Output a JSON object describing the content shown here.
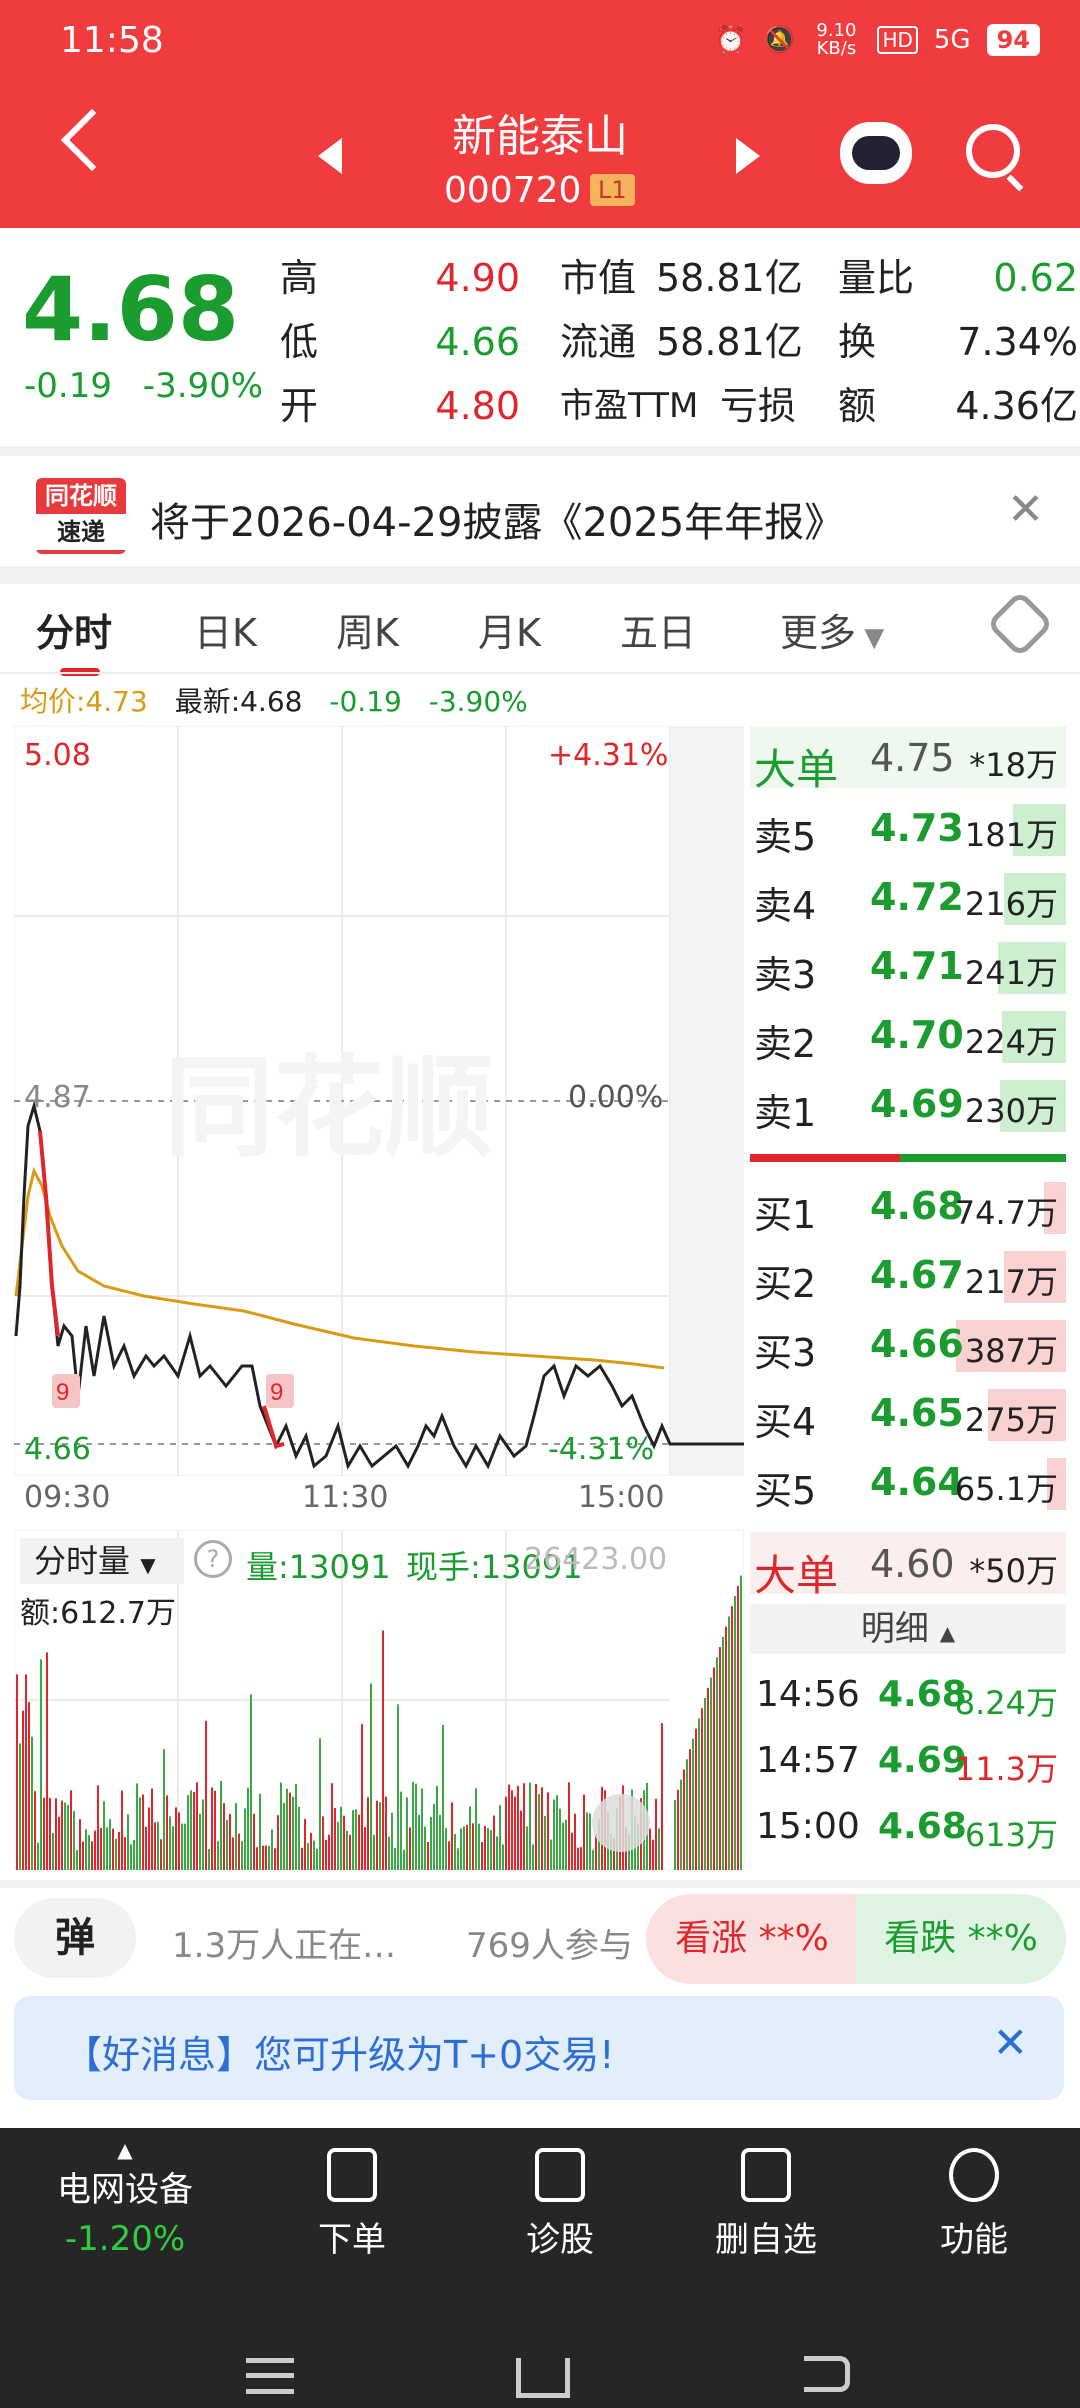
{
  "status": {
    "time": "11:58",
    "net_speed": "9.10 KB/s",
    "network": "5G",
    "battery": "94"
  },
  "header": {
    "stock_name": "新能泰山",
    "stock_code": "000720",
    "level": "L1"
  },
  "quote": {
    "price": "4.68",
    "change": "-0.19",
    "change_pct": "-3.90%",
    "high_label": "高",
    "high": "4.90",
    "low_label": "低",
    "low": "4.66",
    "open_label": "开",
    "open": "4.80",
    "mcap_label": "市值",
    "mcap": "58.81亿",
    "float_label": "流通",
    "float": "58.81亿",
    "pe_label": "市盈TTM",
    "pe": "亏损",
    "vol_ratio_label": "量比",
    "vol_ratio": "0.62",
    "turnover_label": "换",
    "turnover": "7.34%",
    "amount_label": "额",
    "amount": "4.36亿"
  },
  "notice": {
    "logo_top": "同花顺",
    "logo_bottom": "速递",
    "text": "将于2026-04-29披露《2025年年报》"
  },
  "tabs": [
    "分时",
    "日K",
    "周K",
    "月K",
    "五日",
    "更多"
  ],
  "info": {
    "avg": "均价:4.73",
    "latest": "最新:4.68",
    "chg": "-0.19",
    "pct": "-3.90%"
  },
  "chart": {
    "top_price": "5.08",
    "top_pct": "+4.31%",
    "mid_price": "4.87",
    "mid_pct": "0.00%",
    "low_price": "4.66",
    "low_pct": "-4.31%",
    "times": [
      "09:30",
      "11:30",
      "15:00"
    ],
    "watermark": "同花顺",
    "marker": "9"
  },
  "book": {
    "big_sell_label": "大单",
    "big_sell_price": "4.75",
    "big_sell_vol": "*18万",
    "asks": [
      {
        "name": "卖5",
        "price": "4.73",
        "vol": "181万",
        "w": 0.48
      },
      {
        "name": "卖4",
        "price": "4.72",
        "vol": "216万",
        "w": 0.56
      },
      {
        "name": "卖3",
        "price": "4.71",
        "vol": "241万",
        "w": 0.62
      },
      {
        "name": "卖2",
        "price": "4.70",
        "vol": "224万",
        "w": 0.58
      },
      {
        "name": "卖1",
        "price": "4.69",
        "vol": "230万",
        "w": 0.6
      }
    ],
    "bids": [
      {
        "name": "买1",
        "price": "4.68",
        "vol": "74.7万",
        "w": 0.2
      },
      {
        "name": "买2",
        "price": "4.67",
        "vol": "217万",
        "w": 0.56
      },
      {
        "name": "买3",
        "price": "4.66",
        "vol": "387万",
        "w": 1.0
      },
      {
        "name": "买4",
        "price": "4.65",
        "vol": "275万",
        "w": 0.71
      },
      {
        "name": "买5",
        "price": "4.64",
        "vol": "65.1万",
        "w": 0.17
      }
    ],
    "big_buy_label": "大单",
    "big_buy_price": "4.60",
    "big_buy_vol": "*50万"
  },
  "volume": {
    "label": "分时量",
    "vol": "量:13091",
    "cur": "现手:13091",
    "amount": "额:612.7万",
    "axis": "26423.00"
  },
  "detail": {
    "title": "明细",
    "rows": [
      {
        "time": "14:56",
        "price": "4.68",
        "vol": "8.24万"
      },
      {
        "time": "14:57",
        "price": "4.69",
        "vol": "11.3万"
      },
      {
        "time": "15:00",
        "price": "4.68",
        "vol": "613万"
      }
    ]
  },
  "sentiment": {
    "tan": "弹",
    "watching": "1.3万人正在…",
    "participants": "769人参与",
    "up": "看涨 **%",
    "down": "看跌 **%"
  },
  "goodnews": {
    "text": "【好消息】您可升级为T+0交易!"
  },
  "nav": {
    "sector": "电网设备",
    "sector_chg": "-1.20%",
    "items": [
      "下单",
      "诊股",
      "删自选",
      "功能"
    ]
  },
  "colors": {
    "red": "#e0262b",
    "green": "#1a9c2e",
    "header": "#f03c3f",
    "avg_line": "#d99a14"
  }
}
